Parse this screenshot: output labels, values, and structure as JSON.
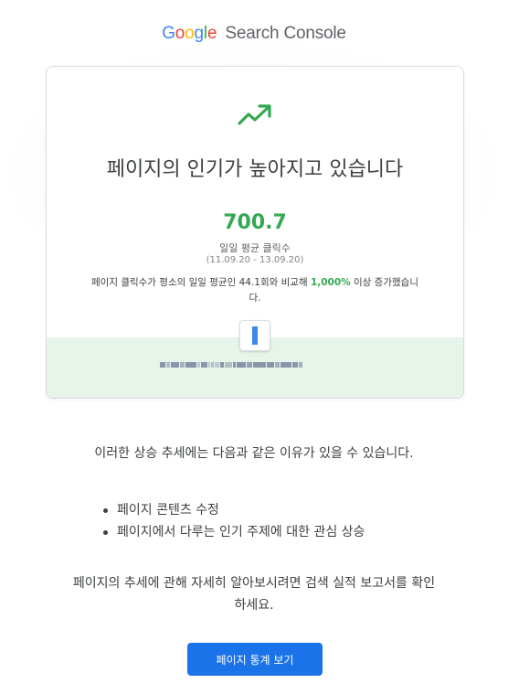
{
  "header": {
    "logo_letters": [
      {
        "char": "G",
        "color": "#4285F4"
      },
      {
        "char": "o",
        "color": "#EA4335"
      },
      {
        "char": "o",
        "color": "#FBBC05"
      },
      {
        "char": "g",
        "color": "#4285F4"
      },
      {
        "char": "l",
        "color": "#34A853"
      },
      {
        "char": "e",
        "color": "#EA4335"
      }
    ],
    "product_name": "Search Console"
  },
  "card": {
    "icon": "trending-up-icon",
    "headline": "페이지의 인기가 높아지고 있습니다",
    "value": "700.7",
    "metric_label": "일일 평균 클릭수",
    "date_range": "(11.09.20 - 13.09.20)",
    "comparison_prefix": "페이지 클릭수가 평소의 일일 평균인 44.1회와 비교해 ",
    "comparison_pct": "1,000%",
    "comparison_suffix": " 이상 증가했습니다.",
    "accent_color": "#34A853",
    "band_color": "#E6F4EA"
  },
  "reasons": {
    "intro": "이러한 상승 추세에는 다음과 같은 이유가 있을 수 있습니다.",
    "items": [
      "페이지 콘텐츠 수정",
      "페이지에서 다루는 인기 주제에 대한 관심 상승"
    ]
  },
  "more": {
    "text": "페이지의 추세에 관해 자세히 알아보시려면 검색 실적 보고서를 확인하세요."
  },
  "cta": {
    "label": "페이지 통계 보기",
    "color": "#1A73E8"
  }
}
